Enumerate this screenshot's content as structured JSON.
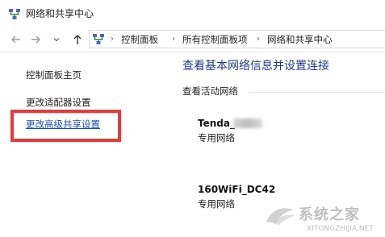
{
  "window": {
    "title": "网络和共享中心",
    "icon": "network-sharing-icon"
  },
  "nav": {
    "back_icon": "arrow-left-icon",
    "forward_icon": "arrow-right-icon",
    "recent_icon": "chevron-down-icon",
    "up_icon": "arrow-up-icon",
    "breadcrumbs": [
      "控制面板",
      "所有控制面板项",
      "网络和共享中心"
    ],
    "separator": "›"
  },
  "sidebar": {
    "items": [
      {
        "label": "控制面板主页"
      },
      {
        "label": "更改适配器设置"
      },
      {
        "label": "更改高级共享设置"
      }
    ]
  },
  "main": {
    "title": "查看基本网络信息并设置连接",
    "section_label": "查看活动网络",
    "networks": [
      {
        "name": "Tenda_",
        "type": "专用网络"
      },
      {
        "name": "160WiFi_DC42",
        "type": "专用网络"
      }
    ]
  },
  "watermark": {
    "text": "系统之家",
    "url": "XITONGZHIJIA.NET"
  },
  "colors": {
    "link_active": "#1a4fa8",
    "title": "#1e3a8a",
    "highlight": "#e53a3a"
  }
}
